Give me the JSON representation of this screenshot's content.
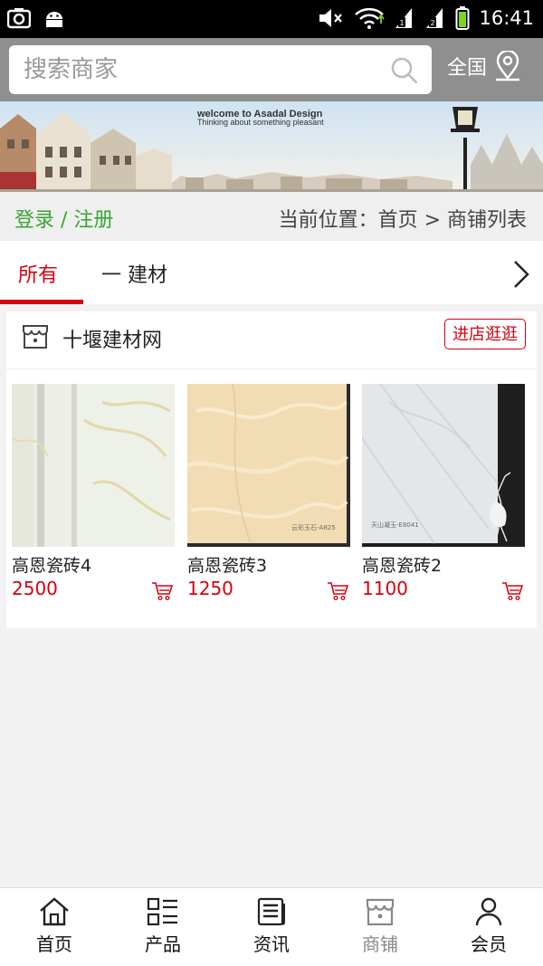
{
  "status_bar": {
    "time": "16:41"
  },
  "search": {
    "placeholder": "搜索商家"
  },
  "region": {
    "label": "全国"
  },
  "banner": {
    "line1": "welcome to Asadal Design",
    "line2": "Thinking about something pleasant"
  },
  "nav_row": {
    "login_label": "登录 / 注册",
    "breadcrumb": "当前位置：首页 > 商铺列表"
  },
  "tabs": [
    {
      "label": "所有",
      "active": true
    },
    {
      "label": "一 建材",
      "active": false
    }
  ],
  "shop": {
    "name": "十堰建材网",
    "enter_button": "进店逛逛",
    "products": [
      {
        "name": "高恩瓷砖4",
        "price": "2500"
      },
      {
        "name": "高恩瓷砖3",
        "price": "1250",
        "tile_label": "云彩玉石-A825"
      },
      {
        "name": "高恩瓷砖2",
        "price": "1100",
        "tile_label": "天山凝玉-E8041"
      }
    ]
  },
  "bottom_nav": [
    {
      "label": "首页",
      "icon": "home-icon"
    },
    {
      "label": "产品",
      "icon": "grid-list-icon"
    },
    {
      "label": "资讯",
      "icon": "news-icon"
    },
    {
      "label": "商铺",
      "icon": "store-icon",
      "active": true
    },
    {
      "label": "会员",
      "icon": "user-icon"
    }
  ],
  "colors": {
    "accent": "#d7000f",
    "green": "#3aa535",
    "header_bg": "#8f8f8f"
  }
}
